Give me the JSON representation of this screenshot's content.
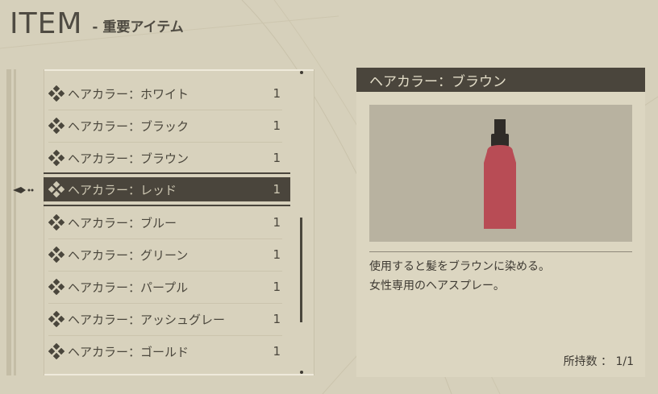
{
  "header": {
    "title": "ITEM",
    "subtitle": "- 重要アイテム"
  },
  "items": [
    {
      "label": "ヘアカラー：ホワイト",
      "qty": "1"
    },
    {
      "label": "ヘアカラー：ブラック",
      "qty": "1"
    },
    {
      "label": "ヘアカラー：ブラウン",
      "qty": "1"
    },
    {
      "label": "ヘアカラー：レッド",
      "qty": "1"
    },
    {
      "label": "ヘアカラー：ブルー",
      "qty": "1"
    },
    {
      "label": "ヘアカラー：グリーン",
      "qty": "1"
    },
    {
      "label": "ヘアカラー：パープル",
      "qty": "1"
    },
    {
      "label": "ヘアカラー：アッシュグレー",
      "qty": "1"
    },
    {
      "label": "ヘアカラー：ゴールド",
      "qty": "1"
    }
  ],
  "detail": {
    "title": "ヘアカラー：ブラウン",
    "image_icon": "spray-bottle-icon",
    "description": [
      "使用すると髪をブラウンに染める。",
      "女性専用のヘアスプレー。"
    ],
    "owned": "所持数 ： 1/1"
  },
  "colors": {
    "panel_dark": "#4a453c",
    "background": "#d6d0bb",
    "bottle": "#b84c55"
  }
}
